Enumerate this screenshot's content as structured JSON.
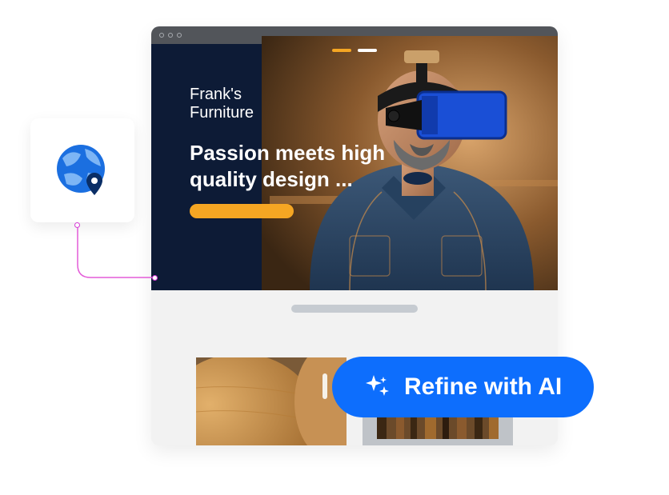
{
  "hero": {
    "brand_line1": "Frank's",
    "brand_line2": "Furniture",
    "headline": "Passion meets high quality design ..."
  },
  "refine": {
    "label": "Refine with AI"
  }
}
